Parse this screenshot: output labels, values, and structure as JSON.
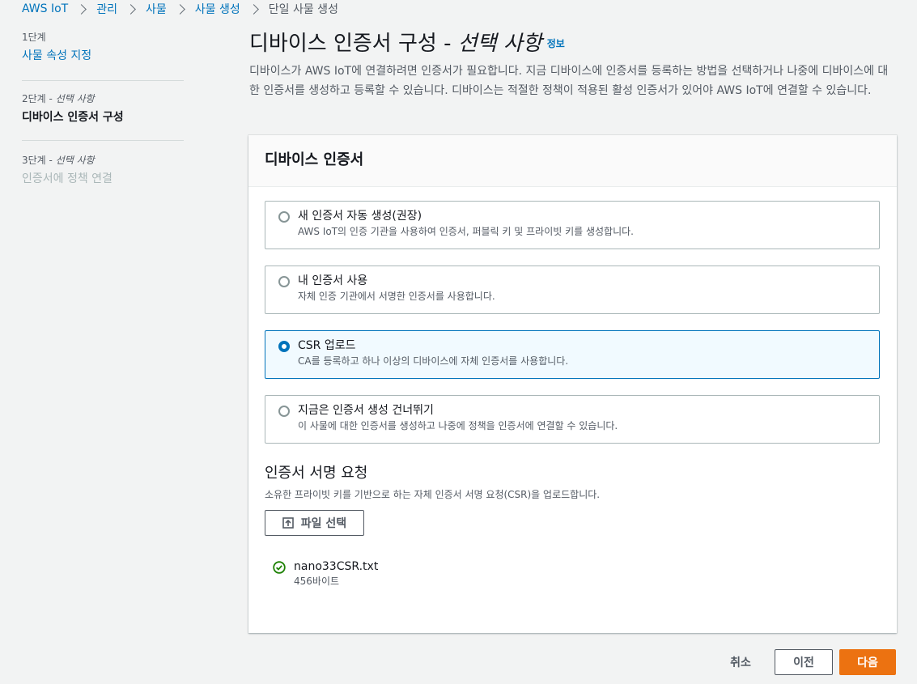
{
  "breadcrumb": {
    "items": [
      "AWS IoT",
      "관리",
      "사물",
      "사물 생성"
    ],
    "current": "단일 사물 생성"
  },
  "steps": [
    {
      "number": "1단계",
      "optional": "",
      "title": "사물 속성 지정"
    },
    {
      "number": "2단계",
      "optional": "선택 사항",
      "title": "디바이스 인증서 구성"
    },
    {
      "number": "3단계",
      "optional": "선택 사항",
      "title": "인증서에 정책 연결"
    }
  ],
  "page": {
    "title": "디바이스 인증서 구성 -",
    "title_optional": "선택 사항",
    "info_link": "정보",
    "description": "디바이스가 AWS IoT에 연결하려면 인증서가 필요합니다. 지금 디바이스에 인증서를 등록하는 방법을 선택하거나 나중에 디바이스에 대한 인증서를 생성하고 등록할 수 있습니다. 디바이스는 적절한 정책이 적용된 활성 인증서가 있어야 AWS IoT에 연결할 수 있습니다."
  },
  "panel": {
    "header": "디바이스 인증서",
    "options": [
      {
        "title": "새 인증서 자동 생성(권장)",
        "description": "AWS IoT의 인증 기관을 사용하여 인증서, 퍼블릭 키 및 프라이빗 키를 생성합니다.",
        "selected": false
      },
      {
        "title": "내 인증서 사용",
        "description": "자체 인증 기관에서 서명한 인증서를 사용합니다.",
        "selected": false
      },
      {
        "title": "CSR 업로드",
        "description": "CA를 등록하고 하나 이상의 디바이스에 자체 인증서를 사용합니다.",
        "selected": true
      },
      {
        "title": "지금은 인증서 생성 건너뛰기",
        "description": "이 사물에 대한 인증서를 생성하고 나중에 정책을 인증서에 연결할 수 있습니다.",
        "selected": false
      }
    ],
    "csr": {
      "title": "인증서 서명 요청",
      "description": "소유한 프라이빗 키를 기반으로 하는 자체 인증서 서명 요청(CSR)을 업로드합니다.",
      "choose_file_label": "파일 선택",
      "file_name": "nano33CSR.txt",
      "file_size": "456바이트"
    }
  },
  "footer": {
    "cancel_label": "취소",
    "previous_label": "이전",
    "next_label": "다음"
  },
  "colors": {
    "link": "#0073bb",
    "primary_button": "#ec7211",
    "selected_border": "#0073bb",
    "success": "#1d8102"
  }
}
